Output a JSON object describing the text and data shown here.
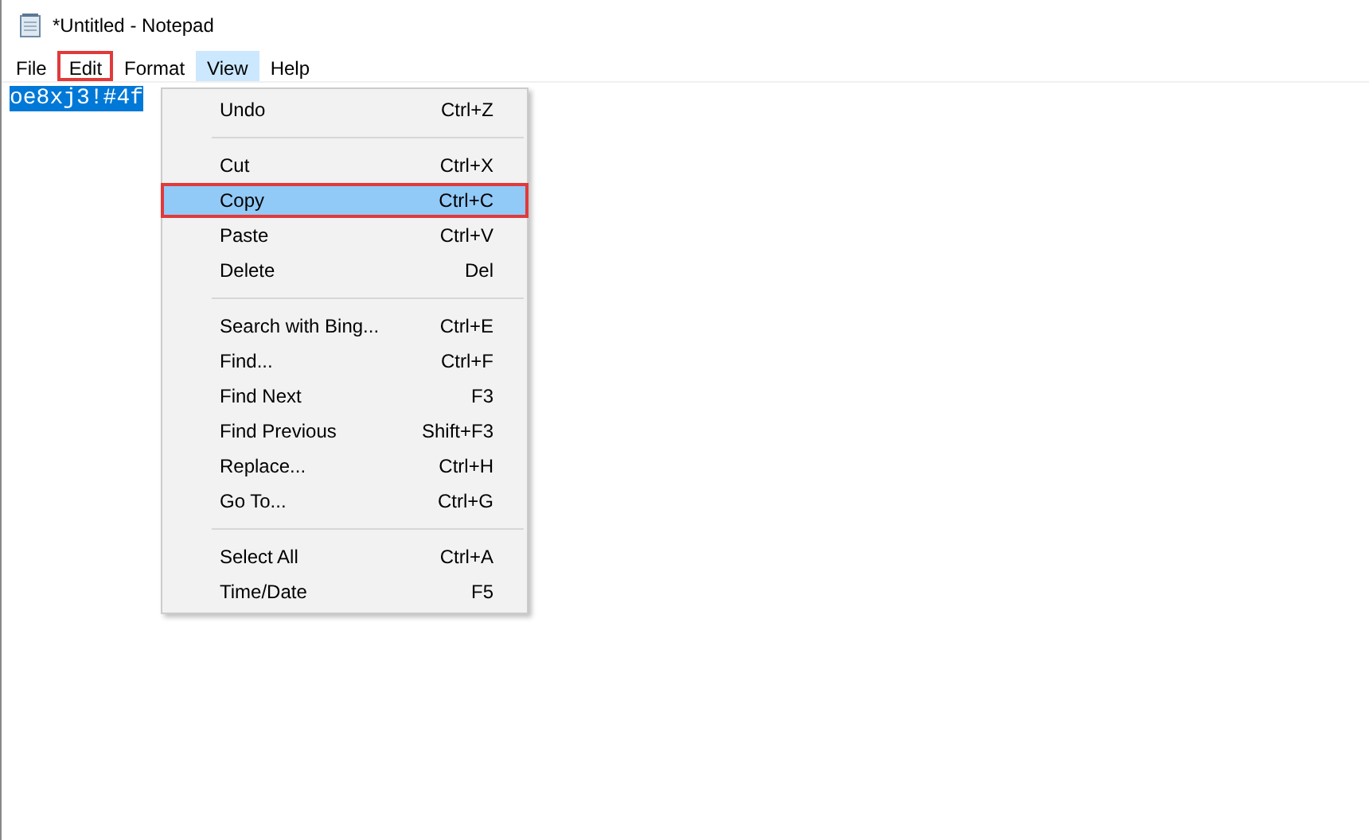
{
  "window": {
    "title": "*Untitled - Notepad"
  },
  "menu_bar": [
    {
      "label": "File",
      "selected": false,
      "annotated": false
    },
    {
      "label": "Edit",
      "selected": false,
      "annotated": true
    },
    {
      "label": "Format",
      "selected": false,
      "annotated": false
    },
    {
      "label": "View",
      "selected": true,
      "annotated": false
    },
    {
      "label": "Help",
      "selected": false,
      "annotated": false
    }
  ],
  "editor": {
    "text": "oe8xj3!#4f",
    "text_selected": true
  },
  "edit_menu": [
    {
      "kind": "item",
      "label": "Undo",
      "shortcut": "Ctrl+Z",
      "selected": false,
      "annotated": false
    },
    {
      "kind": "separator"
    },
    {
      "kind": "item",
      "label": "Cut",
      "shortcut": "Ctrl+X",
      "selected": false,
      "annotated": false
    },
    {
      "kind": "item",
      "label": "Copy",
      "shortcut": "Ctrl+C",
      "selected": true,
      "annotated": true
    },
    {
      "kind": "item",
      "label": "Paste",
      "shortcut": "Ctrl+V",
      "selected": false,
      "annotated": false
    },
    {
      "kind": "item",
      "label": "Delete",
      "shortcut": "Del",
      "selected": false,
      "annotated": false
    },
    {
      "kind": "separator"
    },
    {
      "kind": "item",
      "label": "Search with Bing...",
      "shortcut": "Ctrl+E",
      "selected": false,
      "annotated": false
    },
    {
      "kind": "item",
      "label": "Find...",
      "shortcut": "Ctrl+F",
      "selected": false,
      "annotated": false
    },
    {
      "kind": "item",
      "label": "Find Next",
      "shortcut": "F3",
      "selected": false,
      "annotated": false
    },
    {
      "kind": "item",
      "label": "Find Previous",
      "shortcut": "Shift+F3",
      "selected": false,
      "annotated": false
    },
    {
      "kind": "item",
      "label": "Replace...",
      "shortcut": "Ctrl+H",
      "selected": false,
      "annotated": false
    },
    {
      "kind": "item",
      "label": "Go To...",
      "shortcut": "Ctrl+G",
      "selected": false,
      "annotated": false
    },
    {
      "kind": "separator"
    },
    {
      "kind": "item",
      "label": "Select All",
      "shortcut": "Ctrl+A",
      "selected": false,
      "annotated": false
    },
    {
      "kind": "item",
      "label": "Time/Date",
      "shortcut": "F5",
      "selected": false,
      "annotated": false
    }
  ]
}
